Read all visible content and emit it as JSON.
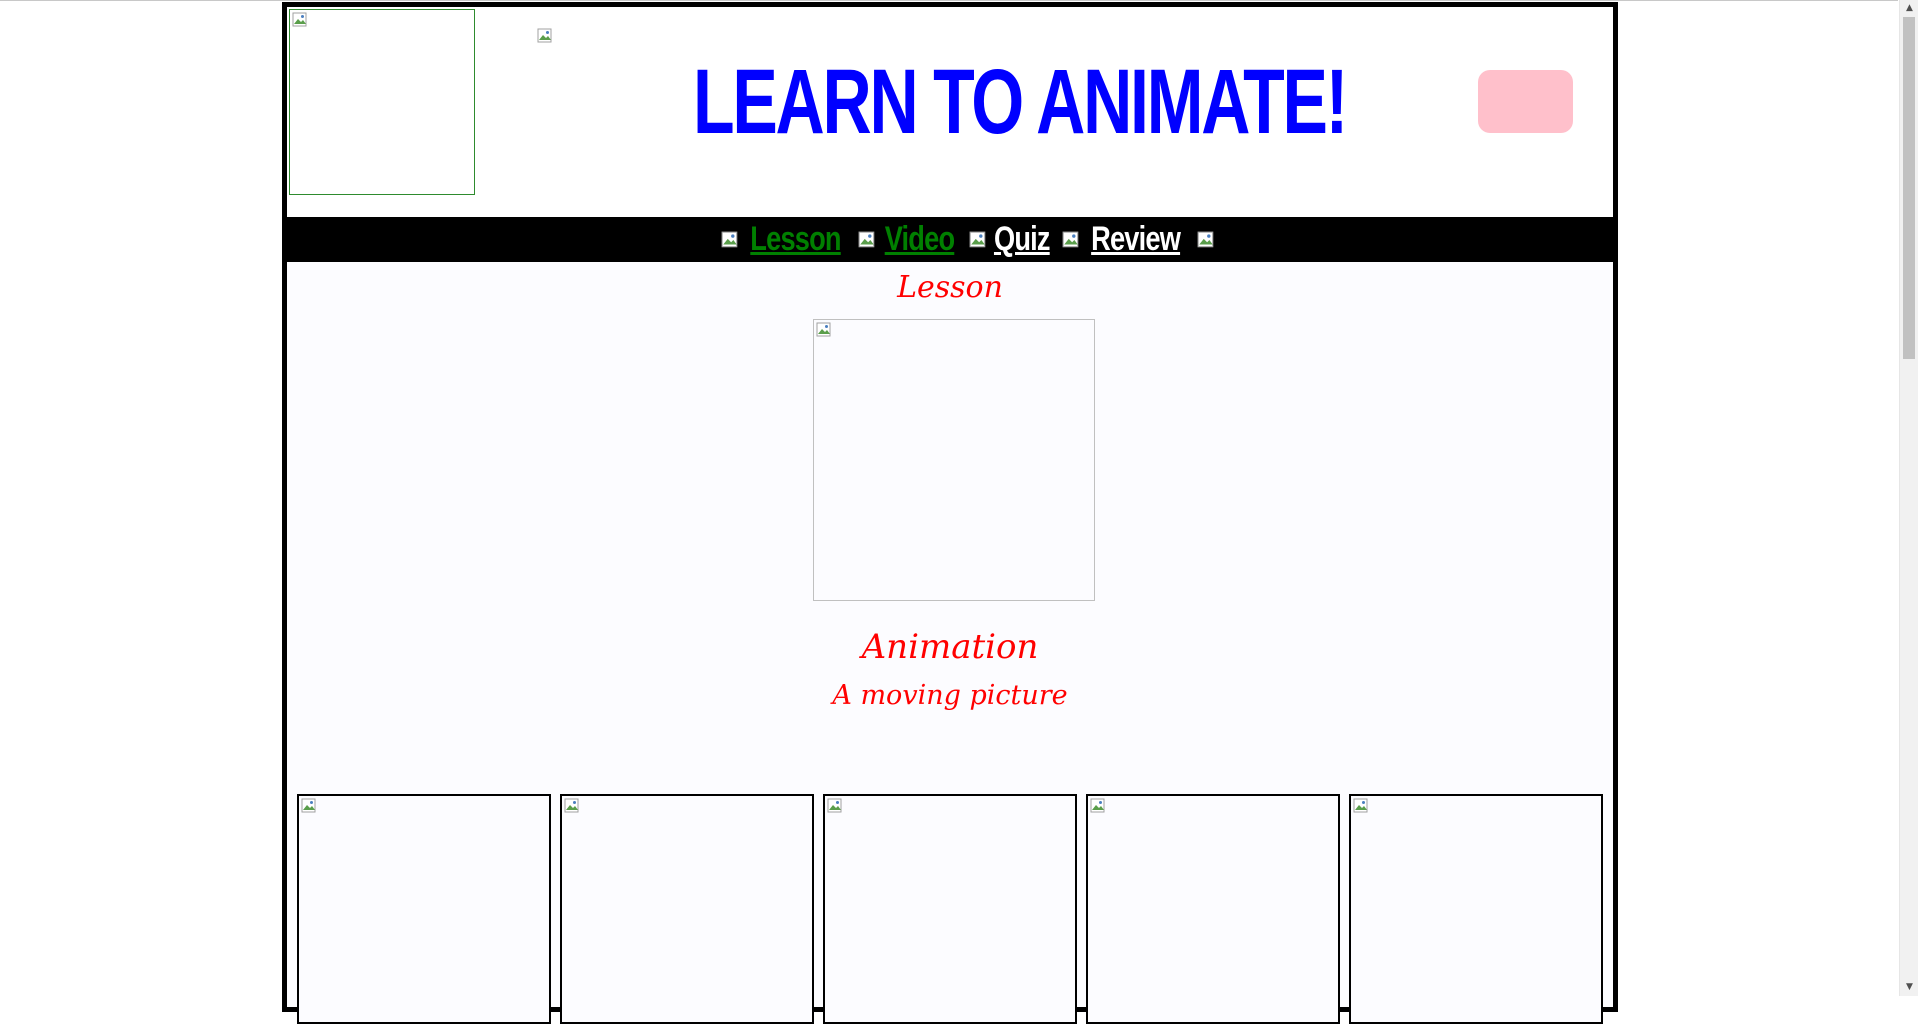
{
  "header": {
    "title": "LEARN TO ANIMATE!",
    "title_color": "#0000ff",
    "button_color": "#ffc0cb",
    "logo_icon": "broken-image-icon",
    "banner_icon": "broken-image-icon"
  },
  "nav": {
    "background": "#000000",
    "items": [
      {
        "label": "Lesson",
        "state": "visited",
        "color": "#008000"
      },
      {
        "label": "Video",
        "state": "visited",
        "color": "#008000"
      },
      {
        "label": "Quiz",
        "state": "unvisited",
        "color": "#ffffff"
      },
      {
        "label": "Review",
        "state": "unvisited",
        "color": "#ffffff"
      }
    ],
    "separator_icon": "broken-image-icon"
  },
  "main": {
    "heading": "Lesson",
    "term": "Animation",
    "definition": "A moving picture",
    "text_color": "#ff0000",
    "thumbnail_count": 5,
    "thumbnail_icon": "broken-image-icon"
  }
}
